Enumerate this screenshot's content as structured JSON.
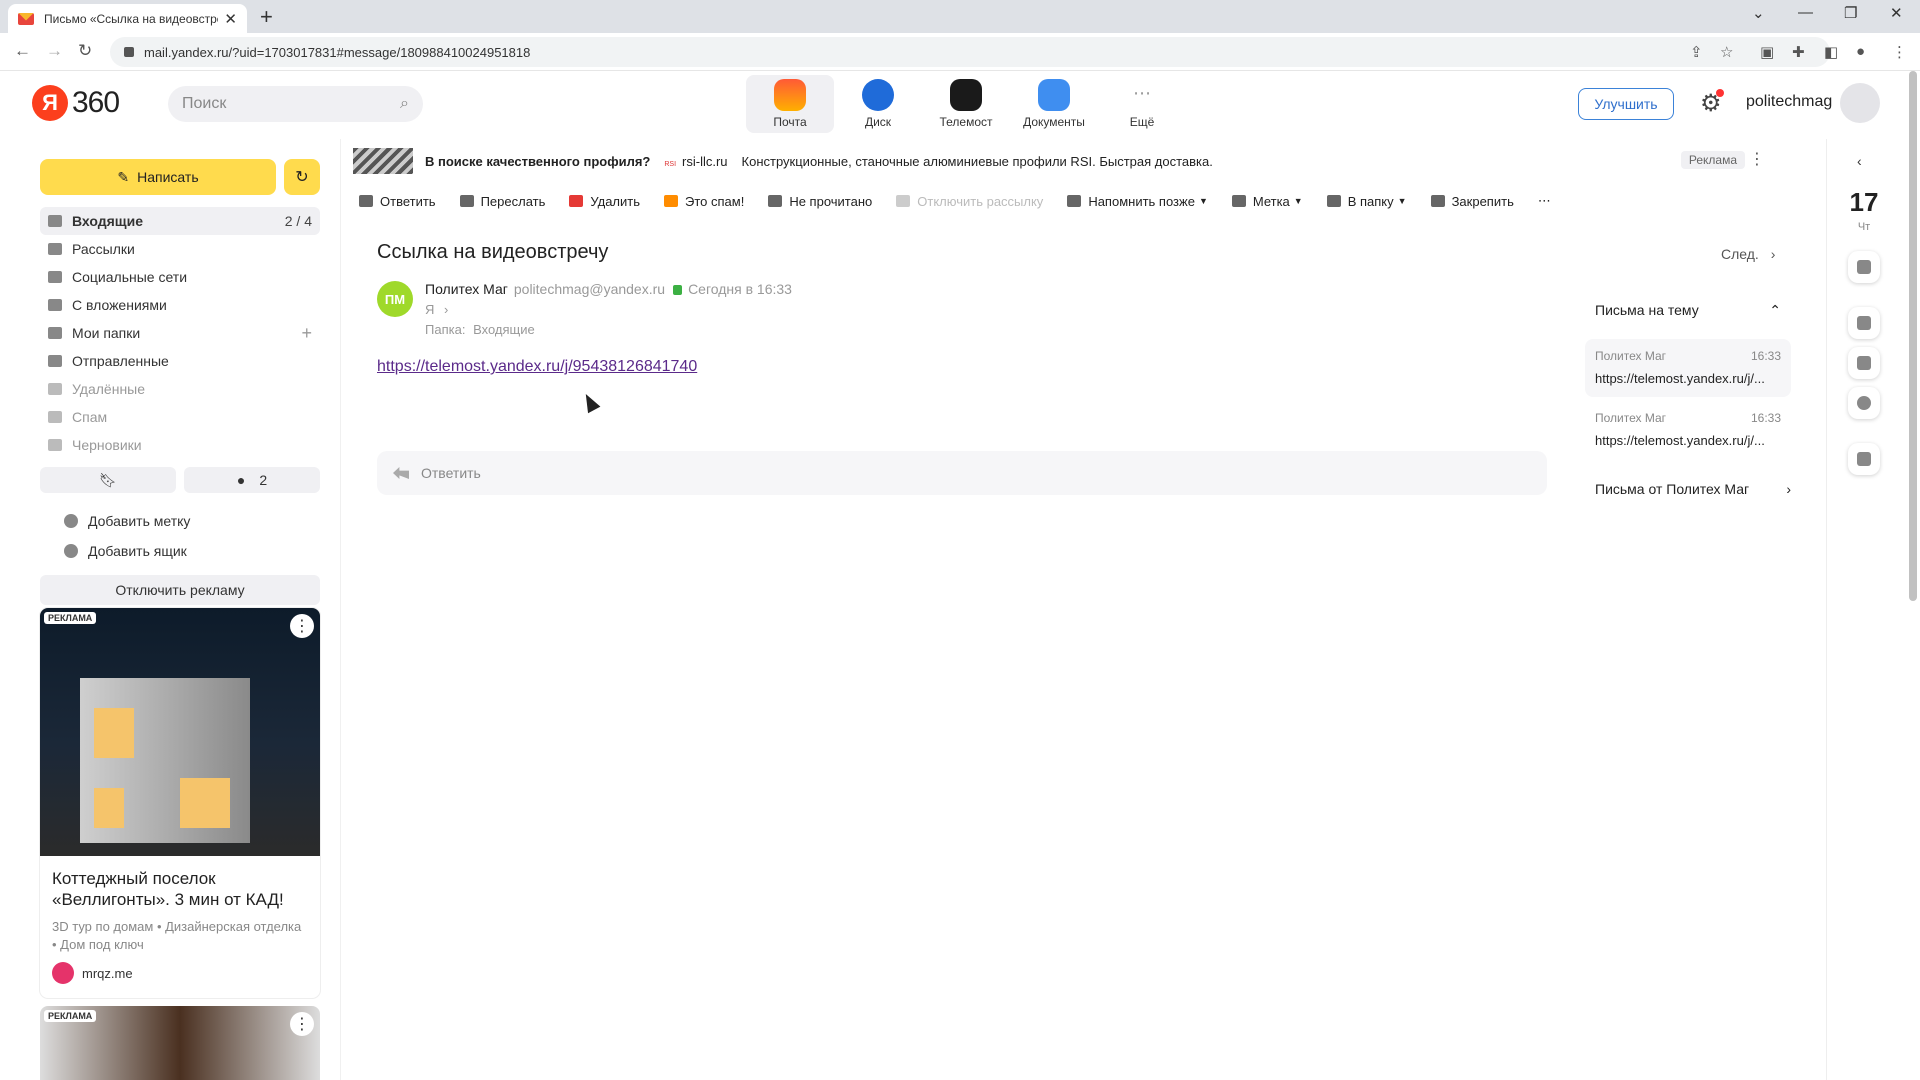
{
  "browser": {
    "tab_title": "Письмо «Ссылка на видеовстре",
    "url": "mail.yandex.ru/?uid=1703017831#message/180988410024951818"
  },
  "header": {
    "logo_letter": "Я",
    "logo_number": "360",
    "search_placeholder": "Поиск",
    "services": [
      {
        "label": "Почта",
        "color": "#ff8a00"
      },
      {
        "label": "Диск",
        "color": "#1f6bd9"
      },
      {
        "label": "Телемост",
        "color": "#1a1a1a"
      },
      {
        "label": "Документы",
        "color": "#3f8ef0"
      },
      {
        "label": "Ещё",
        "color": "#ffffff"
      }
    ],
    "upgrade_label": "Улучшить",
    "username": "politechmag"
  },
  "sidebar": {
    "compose_label": "Написать",
    "folders": [
      {
        "label": "Входящие",
        "count": "2 / 4"
      },
      {
        "label": "Рассылки"
      },
      {
        "label": "Социальные сети"
      },
      {
        "label": "С вложениями"
      },
      {
        "label": "Мои папки",
        "plus": "+"
      },
      {
        "label": "Отправленные"
      },
      {
        "label": "Удалённые"
      },
      {
        "label": "Спам"
      },
      {
        "label": "Черновики"
      }
    ],
    "unread_count": "2",
    "add_label": "Добавить метку",
    "add_mailbox": "Добавить ящик",
    "disable_ads": "Отключить рекламу",
    "ad": {
      "badge": "РЕКЛАМА",
      "title": "Коттеджный поселок «Веллигонты». 3 мин от КАД!",
      "subtitle": "3D тур по домам • Дизайнерская отделка • Дом под ключ",
      "domain": "mrqz.me"
    },
    "ad2_badge": "РЕКЛАМА"
  },
  "banner": {
    "title": "В поиске качественного профиля?",
    "domain": "rsi-llc.ru",
    "text": "Конструкционные, станочные алюминиевые профили RSI. Быстрая доставка.",
    "ad_tag": "Реклама"
  },
  "toolbar": {
    "reply": "Ответить",
    "forward": "Переслать",
    "delete": "Удалить",
    "spam": "Это спам!",
    "unread": "Не прочитано",
    "unsubscribe": "Отключить рассылку",
    "remind": "Напомнить позже",
    "label": "Метка",
    "to_folder": "В папку",
    "pin": "Закрепить"
  },
  "message": {
    "subject": "Ссылка на видеовстречу",
    "next": "След.",
    "avatar_initials": "ПМ",
    "sender_name": "Политех Маг",
    "sender_email": "politechmag@yandex.ru",
    "date": "Сегодня в 16:33",
    "recipient": "Я",
    "folder_label": "Папка:",
    "folder_value": "Входящие",
    "link": "https://telemost.yandex.ru/j/95438126841740",
    "reply_placeholder": "Ответить"
  },
  "thread": {
    "header": "Письма на тему",
    "items": [
      {
        "from": "Политех Маг",
        "time": "16:33",
        "snippet": "https://telemost.yandex.ru/j/..."
      },
      {
        "from": "Политех Маг",
        "time": "16:33",
        "snippet": "https://telemost.yandex.ru/j/..."
      }
    ],
    "from_sender": "Письма от Политех Маг"
  },
  "rail": {
    "day": "17",
    "dow": "Чт"
  }
}
